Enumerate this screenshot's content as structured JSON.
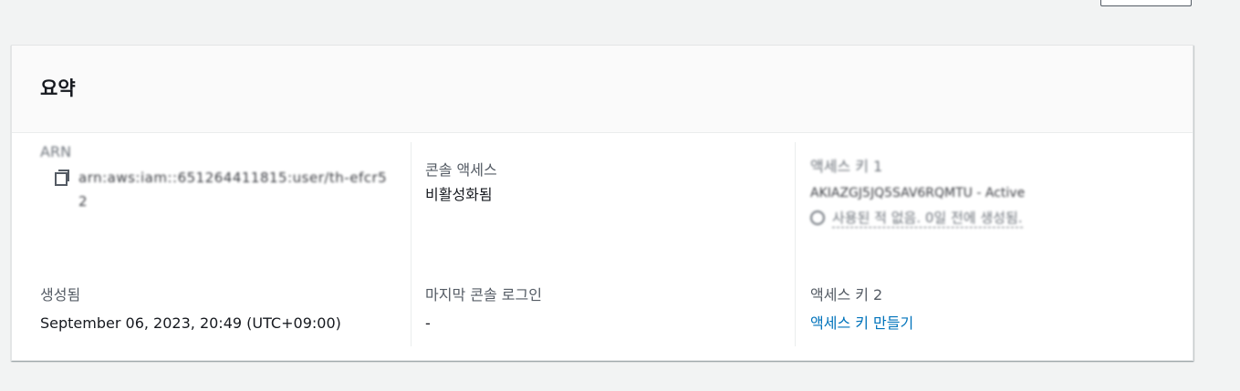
{
  "summary": {
    "title": "요약",
    "arn": {
      "label": "ARN",
      "value": "arn:aws:iam::651264411815:user/th-efcr52"
    },
    "console_access": {
      "label": "콘솔 액세스",
      "value": "비활성화됨"
    },
    "access_key_1": {
      "label": "액세스 키 1",
      "value": "AKIAZGJ5JQ5SAV6RQMTU - Active",
      "status": "사용된 적 없음. 0일 전에 생성됨."
    },
    "created": {
      "label": "생성됨",
      "value": "September 06, 2023, 20:49 (UTC+09:00)"
    },
    "last_console_login": {
      "label": "마지막 콘솔 로그인",
      "value": "-"
    },
    "access_key_2": {
      "label": "액세스 키 2",
      "link": "액세스 키 만들기"
    }
  }
}
